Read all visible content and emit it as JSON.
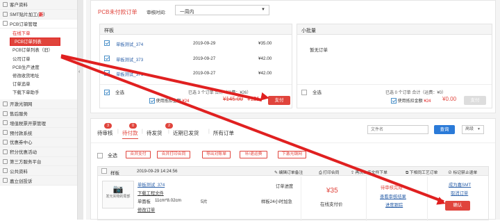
{
  "sidebar": {
    "items_top": [
      {
        "label": "客户资料"
      },
      {
        "label": "SMT贴片加工(",
        "new": "新",
        "suffix": ")"
      },
      {
        "label": "PCB订单管理"
      }
    ],
    "sub_items": [
      {
        "label": "在线下单",
        "style": "red"
      },
      {
        "label": "PCB订单列表",
        "style": "active"
      },
      {
        "label": "PCB订单列表（旧）"
      },
      {
        "label": "公司订单"
      },
      {
        "label": "PCB生产进度"
      },
      {
        "label": "修改收货地址"
      },
      {
        "label": "订单追单"
      },
      {
        "label": "下载下单助手"
      }
    ],
    "items_bottom": [
      {
        "label": "开激光钢网"
      },
      {
        "label": "售后服务"
      },
      {
        "label": "增值税票开票管理"
      },
      {
        "label": "预付款系统"
      },
      {
        "label": "优惠券中心"
      },
      {
        "label": "积分优惠活动"
      },
      {
        "label": "第三方服务平台"
      },
      {
        "label": "公共资料"
      },
      {
        "label": "嘉立创投诉"
      }
    ],
    "collapse_icon": "‹"
  },
  "unpaid": {
    "title": "PCB未付款订单",
    "filter_label": "审核时间:",
    "filter_value": "一周内",
    "sample_header": "样板",
    "small_batch_header": "小批量",
    "rows": [
      {
        "name": "单板测试_374",
        "date": "2019-09-29",
        "price": "¥35.00"
      },
      {
        "name": "单板测试_373",
        "date": "2019-09-27",
        "price": "¥42.00"
      },
      {
        "name": "单板测试_371",
        "date": "2019-09-27",
        "price": "¥42.00"
      }
    ],
    "empty_text": "暂无订单",
    "select_all": "全选",
    "summary_left": "已选 3 个订单 合计（运费：¥26）",
    "coupon_label": "使用抵扣金额",
    "coupon_amount": "¥24",
    "old_total": "¥145.00",
    "new_total": "¥121",
    "pay_button": "支付",
    "summary_right": "已选 0 个订单 合计（运费：¥0）",
    "coupon_amount_right": "¥24",
    "total_right": "¥0.00",
    "pay_button_right": "支付"
  },
  "orders": {
    "tabs": [
      {
        "label": "待审核",
        "badge": "3"
      },
      {
        "label": "待付款",
        "badge": "0",
        "active": true
      },
      {
        "label": "待发货",
        "badge": "2"
      },
      {
        "label": "近期已发货"
      },
      {
        "label": "所有订单"
      }
    ],
    "search_placeholder": "文件名",
    "search_button": "查询",
    "advanced": "高级",
    "select_all": "全选",
    "actions": [
      "合并支付",
      "合并打印合同",
      "导出对账单",
      "补/退运费",
      "下激光钢网"
    ],
    "card": {
      "type": "样板",
      "datetime": "2019-09-29 14:24:56",
      "tools": [
        "编辑订单备注",
        "打印合同",
        "再次上传文件下单",
        "下相同工艺订单",
        "标记禁止退单"
      ],
      "thumb_label": "发元实物的局部",
      "name": "单板测试_374",
      "download": "下载工程文件",
      "spec_label": "单面板",
      "spec_size": "11cm*8.02cm",
      "spec_qty": "5片",
      "modify": "修改订单",
      "status": "订单进度",
      "delivery": "样板24小时加急",
      "price": "¥35",
      "pay_note": "在线支付价",
      "review_done": "待审核完成",
      "review_link": "查看审核结果",
      "track_link": "进度跟踪",
      "smt_link": "成为嘉SMT",
      "cancel_link": "取消订单",
      "confirm_button": "确认"
    }
  },
  "colors": {
    "accent": "#e0443c",
    "blue": "#2a7ad8"
  }
}
